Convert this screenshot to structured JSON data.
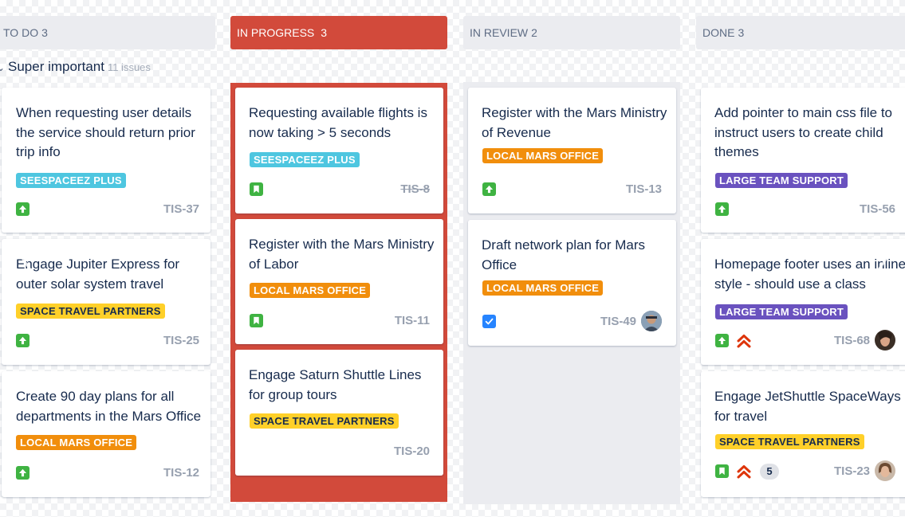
{
  "columns": [
    {
      "name": "TO DO",
      "count": "3"
    },
    {
      "name": "IN PROGRESS",
      "count": "3"
    },
    {
      "name": "IN REVIEW",
      "count": "2"
    },
    {
      "name": "DONE",
      "count": "3"
    }
  ],
  "swimlane": {
    "title": "Super important",
    "subtitle": "11 issues"
  },
  "cards": {
    "todo": [
      {
        "title": "When requesting user details the service should return prior trip info",
        "label": "SEESPACEEZ PLUS",
        "type": "story",
        "key": "TIS-37"
      },
      {
        "title": "Engage Jupiter Express for outer solar system travel",
        "label": "SPACE TRAVEL PARTNERS",
        "type": "story",
        "key": "TIS-25"
      },
      {
        "title": "Create 90 day plans for all departments in the Mars Office",
        "label": "LOCAL MARS OFFICE",
        "type": "story",
        "key": "TIS-12"
      }
    ],
    "inprogress": [
      {
        "title": "Requesting available flights is now taking > 5 seconds",
        "label": "SEESPACEEZ PLUS",
        "type": "bookmark",
        "key": "TIS-8"
      },
      {
        "title": "Register with the Mars Ministry of Labor",
        "label": "LOCAL MARS OFFICE",
        "type": "bookmark",
        "key": "TIS-11"
      },
      {
        "title": "Engage Saturn Shuttle Lines for group tours",
        "label": "SPACE TRAVEL PARTNERS",
        "key": "TIS-20"
      }
    ],
    "inreview": [
      {
        "title": "Register with the Mars Ministry of Revenue",
        "label": "LOCAL MARS OFFICE",
        "type": "story",
        "key": "TIS-13"
      },
      {
        "title": "Draft network plan for Mars Office",
        "label": "LOCAL MARS OFFICE",
        "type": "task",
        "key": "TIS-49"
      }
    ],
    "done": [
      {
        "title": "Add pointer to main css file to instruct users to create child themes",
        "label": "LARGE TEAM SUPPORT",
        "type": "story",
        "key": "TIS-56"
      },
      {
        "title": "Homepage footer uses an inline style - should use a class",
        "label": "LARGE TEAM SUPPORT",
        "type": "story",
        "priority": "highest",
        "key": "TIS-68"
      },
      {
        "title": "Engage JetShuttle SpaceWays for travel",
        "label": "SPACE TRAVEL PARTNERS",
        "type": "bookmark",
        "priority": "highest",
        "estimate": "5",
        "key": "TIS-23"
      }
    ]
  },
  "colors": {
    "active_column": "#d24a3b",
    "label_teal": "#4ec6e0",
    "label_orange": "#f18e0c",
    "label_yellow": "#ffd029",
    "label_purple": "#6a52bf",
    "story_green": "#3fb342",
    "task_blue": "#2684ff"
  }
}
